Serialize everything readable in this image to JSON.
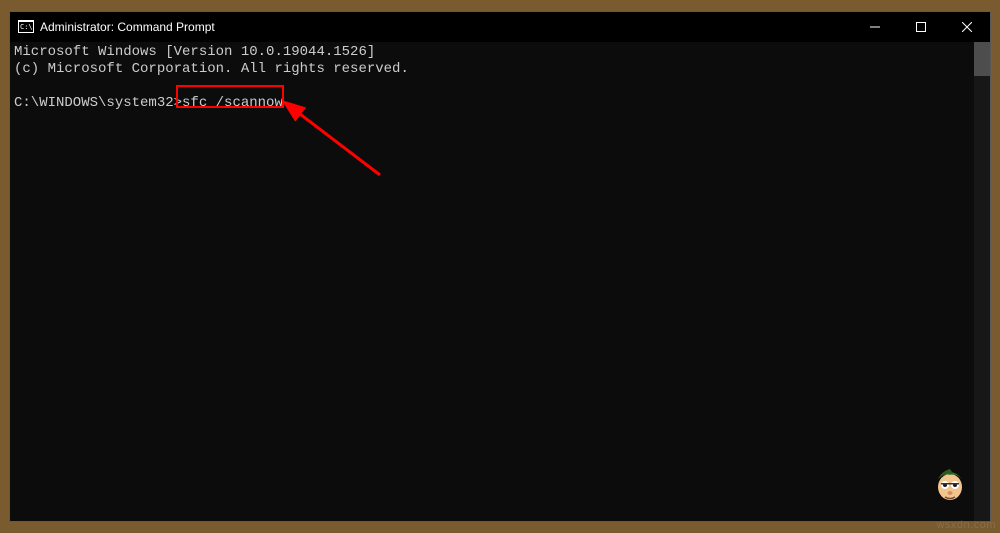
{
  "titlebar": {
    "title": "Administrator: Command Prompt"
  },
  "console": {
    "line1": "Microsoft Windows [Version 10.0.19044.1526]",
    "line2": "(c) Microsoft Corporation. All rights reserved.",
    "blank": "",
    "prompt": "C:\\WINDOWS\\system32>",
    "command": "sfc /scannow"
  },
  "watermark": "wsxdn.com"
}
